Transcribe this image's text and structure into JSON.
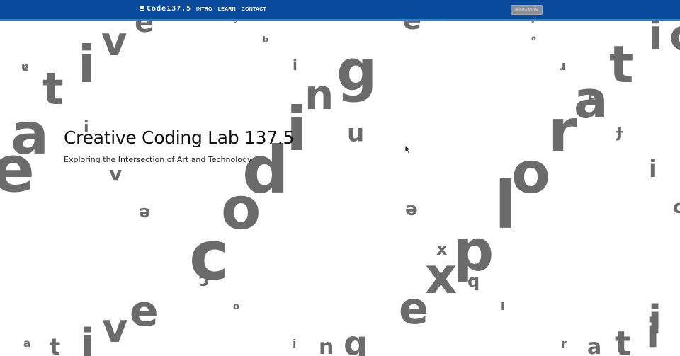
{
  "header": {
    "logo_text": "Code137.5",
    "nav": [
      {
        "label": "INTRO"
      },
      {
        "label": "LEARN"
      },
      {
        "label": "CONTACT"
      }
    ],
    "debug_button_label": "DEBUG MODE"
  },
  "hero": {
    "title": "Creative Coding Lab 137.5",
    "subtitle": "Exploring the Intersection of Art and Technology"
  },
  "floating_letters": [
    "v",
    "e",
    "i",
    "t",
    "a",
    "e",
    "a",
    "i",
    "v",
    "e",
    "b",
    "i",
    "g",
    "n",
    "n",
    "i",
    "o",
    "d",
    "c",
    "o",
    "c",
    "b",
    "e",
    "x",
    "o",
    "r",
    "o",
    "t",
    "a",
    "a",
    "r",
    "i",
    "ɟ",
    "l",
    "o",
    "r",
    "e",
    "p",
    "x",
    "x",
    "e",
    "q",
    "l",
    "o",
    "i",
    "i",
    "c",
    "v",
    "e",
    "a",
    "t",
    "i",
    "i",
    "n",
    "g",
    "r",
    "a",
    "t",
    "i"
  ],
  "colors": {
    "topbar": "#0a4a9c",
    "topbar_border": "#3d79c9",
    "letters": "#6b6b6b",
    "debug_button": "#8b8f96"
  }
}
